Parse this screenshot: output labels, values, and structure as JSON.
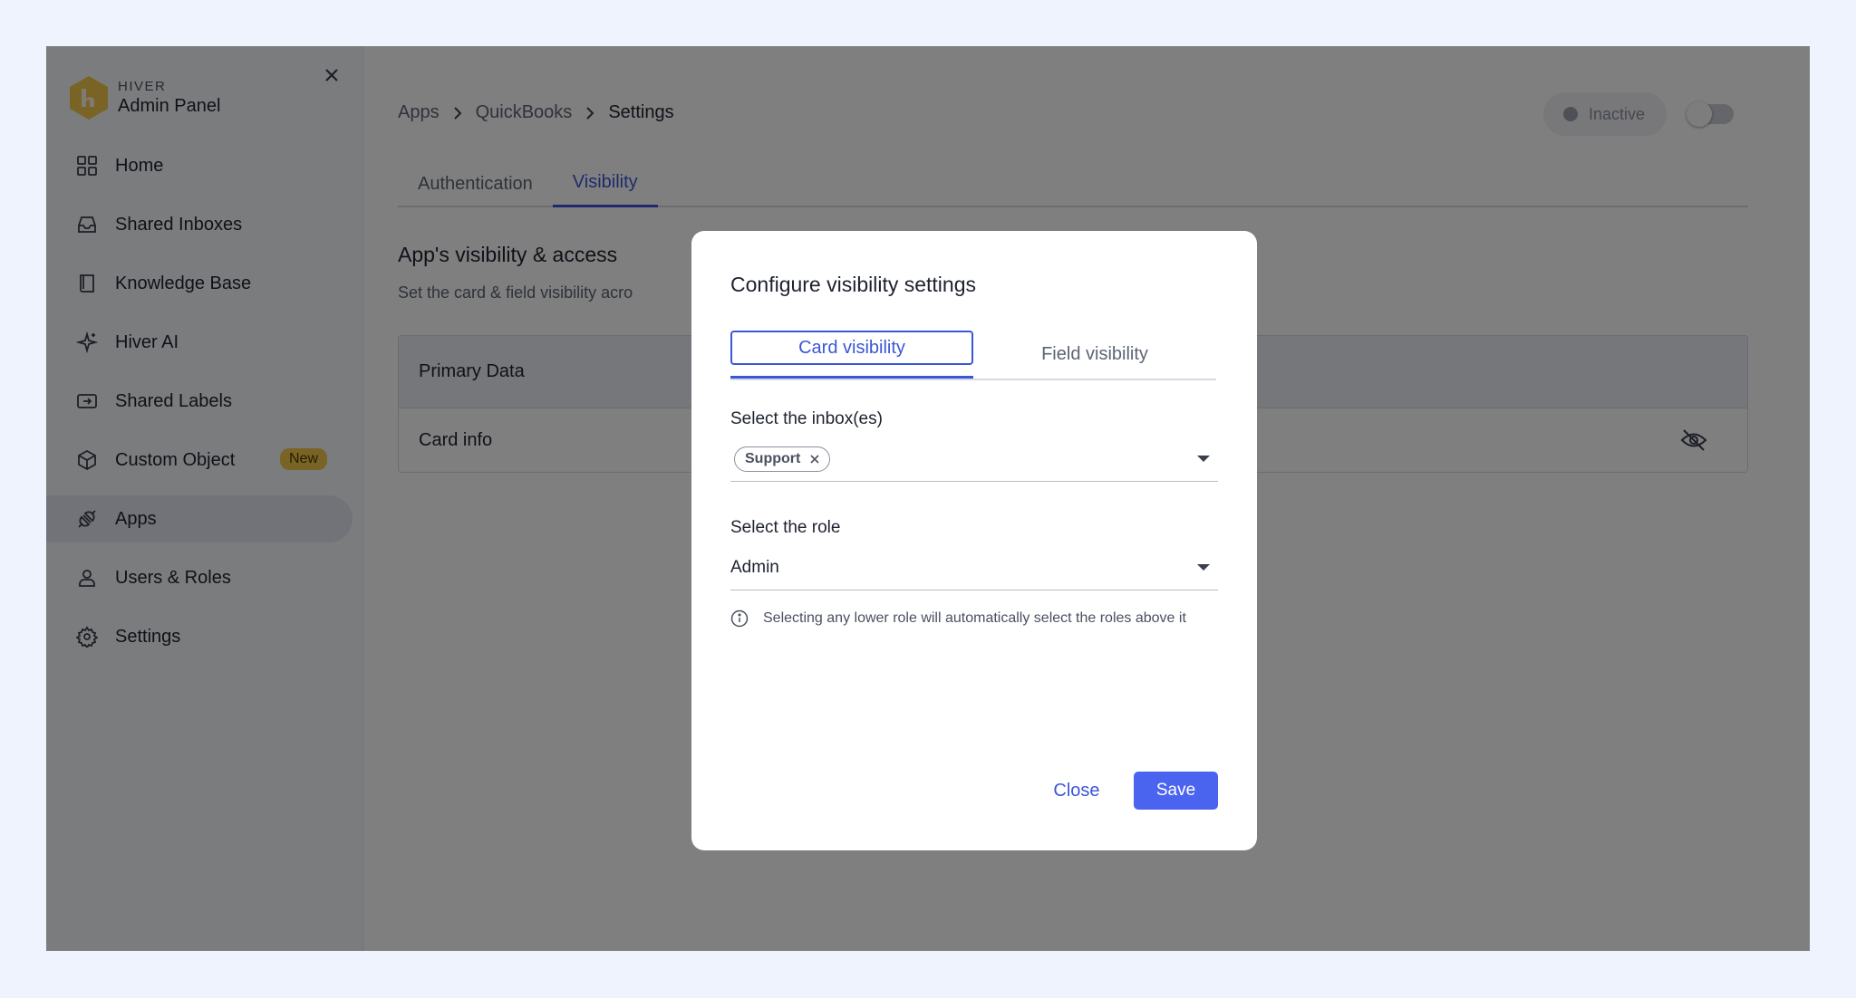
{
  "brand": {
    "small": "HIVER",
    "big": "Admin Panel",
    "logo_color": "#f3c94a"
  },
  "sidebar": {
    "items": [
      {
        "label": "Home",
        "icon": "grid-icon"
      },
      {
        "label": "Shared Inboxes",
        "icon": "inbox-icon"
      },
      {
        "label": "Knowledge Base",
        "icon": "book-icon"
      },
      {
        "label": "Hiver AI",
        "icon": "sparkle-icon"
      },
      {
        "label": "Shared Labels",
        "icon": "label-icon"
      },
      {
        "label": "Custom Object",
        "icon": "cube-icon",
        "badge": "New"
      },
      {
        "label": "Apps",
        "icon": "plug-icon",
        "active": true
      },
      {
        "label": "Users & Roles",
        "icon": "user-icon"
      },
      {
        "label": "Settings",
        "icon": "gear-icon"
      }
    ]
  },
  "breadcrumb": {
    "items": [
      "Apps",
      "QuickBooks",
      "Settings"
    ]
  },
  "status": {
    "label": "Inactive",
    "toggle_on": false
  },
  "tabs": [
    {
      "label": "Authentication",
      "active": false
    },
    {
      "label": "Visibility",
      "active": true
    }
  ],
  "section": {
    "title": "App's visibility & access",
    "subtitle": "Set the card & field visibility acro"
  },
  "table": {
    "header": "Primary Data",
    "row_label": "Card info"
  },
  "modal": {
    "title": "Configure visibility settings",
    "tabs": [
      {
        "label": "Card visibility",
        "active": true
      },
      {
        "label": "Field visibility",
        "active": false
      }
    ],
    "inbox_label": "Select the inbox(es)",
    "inbox_chips": [
      "Support"
    ],
    "role_label": "Select the role",
    "role_value": "Admin",
    "hint": "Selecting any lower role will automatically select the roles above it",
    "close_label": "Close",
    "save_label": "Save"
  },
  "colors": {
    "accent": "#3a56d8",
    "save_button": "#4a64ef",
    "badge": "#f3c94a"
  }
}
